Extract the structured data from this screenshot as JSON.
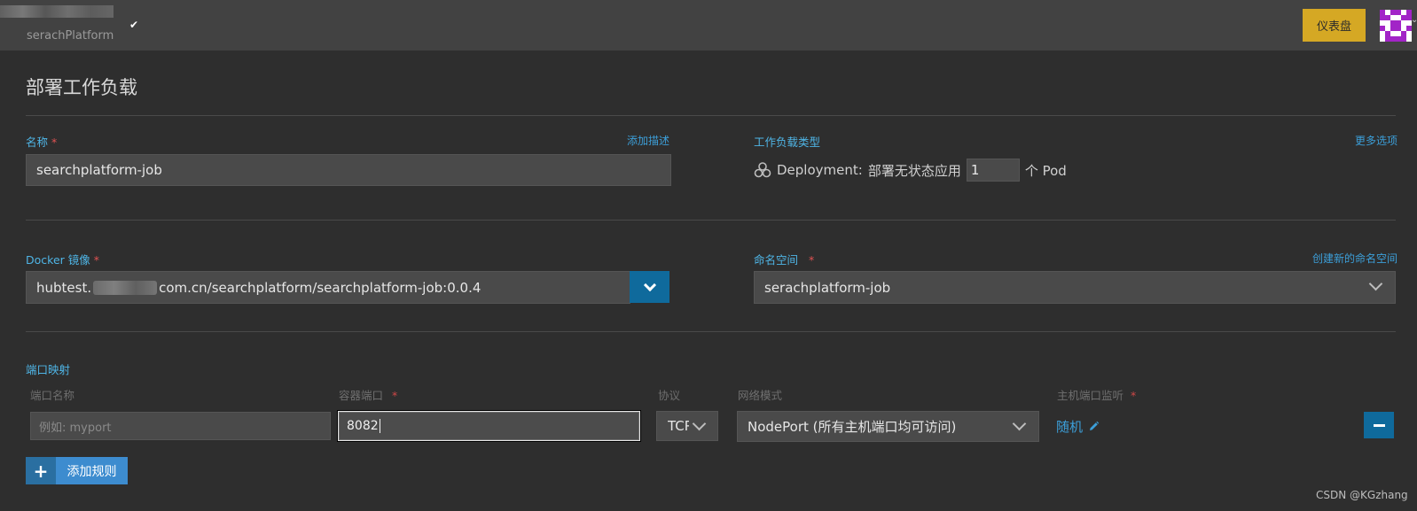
{
  "topbar": {
    "project_name": "serachPlatform",
    "check_glyph": "✔",
    "dashboard_label": "仪表盘",
    "avatar_caret": "⌄"
  },
  "page": {
    "title": "部署工作负载"
  },
  "name_section": {
    "label": "名称",
    "required_mark": "*",
    "add_description_link": "添加描述",
    "value": "searchplatform-job"
  },
  "workload_type": {
    "label": "工作负载类型",
    "more_options_link": "更多选项",
    "icon": "deployment-icon",
    "kind": "Deployment:",
    "kind_desc": "部署无状态应用",
    "replicas": "1",
    "unit": "个 Pod"
  },
  "docker_image": {
    "label": "Docker 镜像",
    "required_mark": "*",
    "value_prefix": "hubtest.",
    "value_suffix": "com.cn/searchplatform/searchplatform-job:0.0.4"
  },
  "namespace": {
    "label": "命名空间",
    "required_mark": "*",
    "create_link": "创建新的命名空间",
    "value": "serachplatform-job"
  },
  "port_mapping": {
    "label": "端口映射",
    "columns": {
      "port_name": "端口名称",
      "container_port": "容器端口",
      "protocol": "协议",
      "network_mode": "网络模式",
      "host_port": "主机端口监听"
    },
    "required_mark": "*",
    "row": {
      "port_name_placeholder": "例如: myport",
      "container_port": "8082",
      "protocol": "TCP",
      "network_mode": "NodePort (所有主机端口均可访问)",
      "host_port": "随机"
    },
    "add_rule_label": "添加规则",
    "add_rule_glyph": "+"
  },
  "watermark": "CSDN @KGzhang",
  "colors": {
    "accent_blue": "#0f6a9c",
    "link_blue": "#3c9fd9",
    "dashboard_yellow": "#d5a824",
    "required_red": "#e05252",
    "background": "#2e2e2e"
  }
}
